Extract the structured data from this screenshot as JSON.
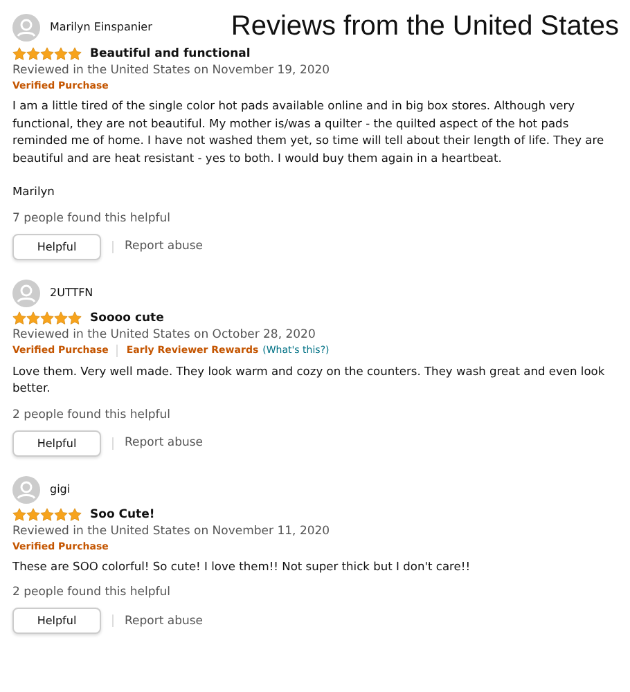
{
  "title": "Reviews from the United States",
  "reviews": [
    {
      "reviewer": "Marilyn Einspanier",
      "stars": 5,
      "headline": "Beautiful and functional",
      "date": "Reviewed in the United States on November 19, 2020",
      "badges": [
        {
          "text": "Verified Purchase",
          "kind": "verified"
        }
      ],
      "body": [
        "I am a little tired of the single color hot pads available online and in big box stores. Although very functional, they are not beautiful. My mother is/was a quilter - the quilted aspect of the hot pads reminded me of home. I have not washed them yet, so time will tell about their length of life. They are beautiful and are heat resistant - yes to both. I would buy them again in a heartbeat.",
        "Marilyn"
      ],
      "helpful_count": "7 people found this helpful",
      "helpful_button": "Helpful",
      "report": "Report abuse"
    },
    {
      "reviewer": "2UTTFN",
      "stars": 5,
      "headline": "Soooo cute",
      "date": "Reviewed in the United States on October 28, 2020",
      "badges": [
        {
          "text": "Verified Purchase",
          "kind": "verified"
        },
        {
          "text": "Early Reviewer Rewards",
          "kind": "reward"
        },
        {
          "text": "(What's this?)",
          "kind": "link"
        }
      ],
      "body": [
        "Love them. Very well made. They look warm and cozy on the counters. They wash great and even look better."
      ],
      "helpful_count": "2 people found this helpful",
      "helpful_button": "Helpful",
      "report": "Report abuse"
    },
    {
      "reviewer": "gigi",
      "stars": 5,
      "headline": "Soo Cute!",
      "date": "Reviewed in the United States on November 11, 2020",
      "badges": [
        {
          "text": "Verified Purchase",
          "kind": "verified"
        }
      ],
      "body": [
        "These are SOO colorful! So cute! I love them!! Not super thick but I don't care!!"
      ],
      "helpful_count": "2 people found this helpful",
      "helpful_button": "Helpful",
      "report": "Report abuse"
    }
  ]
}
